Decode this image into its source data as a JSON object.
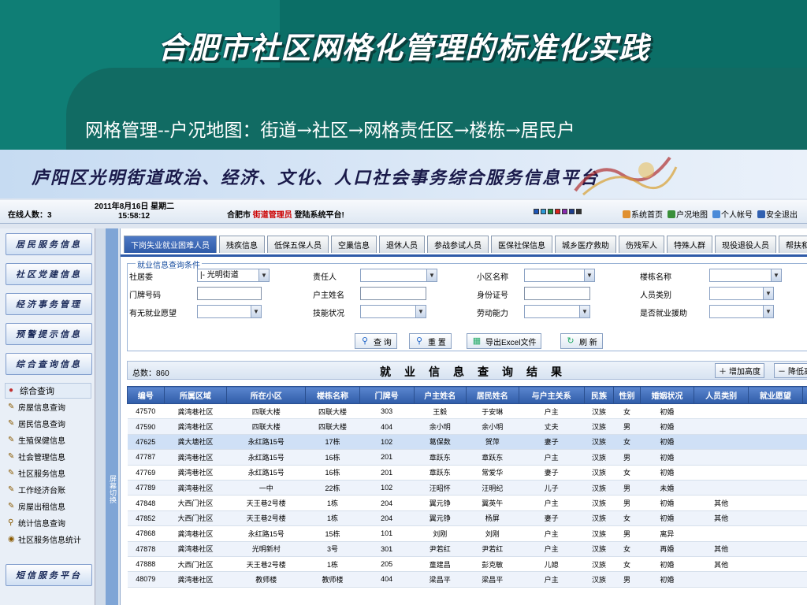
{
  "slide": {
    "title": "合肥市社区网格化管理的标准化实践",
    "subtitle": "网格管理--户况地图：街道→社区→网格责任区→楼栋→居民户"
  },
  "banner": {
    "title": "庐阳区光明街道政治、经济、文化、人口社会事务综合服务信息平台"
  },
  "topbar": {
    "online": "在线人数：3",
    "date": "2011年8月16日  星期二",
    "time": "15:58:12",
    "city": "合肥市",
    "role": "街道管理员",
    "welcome": "登陆系统平台!",
    "colors": [
      "#1e56b8",
      "#2c9ad8",
      "#1d8c3a",
      "#d8221c",
      "#8a2cb0",
      "#1b3d8f",
      "#333333"
    ],
    "links": [
      {
        "icon": "mail-icon",
        "label": "系统首页"
      },
      {
        "icon": "map-icon",
        "label": "户况地图"
      },
      {
        "icon": "user-icon",
        "label": "个人帐号"
      },
      {
        "icon": "exit-icon",
        "label": "安全退出"
      }
    ]
  },
  "sidebar": {
    "buttons": [
      "居民服务信息",
      "社区党建信息",
      "经济事务管理",
      "预警提示信息",
      "综合查询信息"
    ],
    "bottom_button": "短信服务平台",
    "tree_head": "综合查询",
    "tree_items": [
      "房屋信息查询",
      "居民信息查询",
      "生殖保健信息",
      "社会管理信息",
      "社区服务信息",
      "工作经济台账",
      "房屋出租信息",
      "统计信息查询",
      "社区服务信息统计"
    ],
    "strip_label": "屏幕切换"
  },
  "tabs": [
    "下岗失业就业困难人员",
    "残疾信息",
    "低保五保人员",
    "空巢信息",
    "退休人员",
    "参战参试人员",
    "医保社保信息",
    "城乡医疗救助",
    "伤残军人",
    "特殊人群",
    "现役退役人员",
    "帮扶和慰问"
  ],
  "query": {
    "legend": "就业信息查询条件",
    "labels": {
      "committee": "社居委",
      "owner": "责任人",
      "community": "小区名称",
      "building": "楼栋名称",
      "door": "门牌号码",
      "householder": "户主姓名",
      "idcard": "身份证号",
      "category": "人员类别",
      "will": "有无就业愿望",
      "skill": "技能状况",
      "ability": "劳动能力",
      "assist": "是否就业援助"
    },
    "committee_value": "|- 光明街道",
    "buttons": {
      "search": "查 询",
      "reset": "重 置",
      "export": "导出Excel文件",
      "refresh": "刷 新"
    }
  },
  "results": {
    "total": "总数：860",
    "title": "就业信息查询结果",
    "increase": "增加高度",
    "decrease": "降低高度",
    "columns": [
      "编号",
      "所属区域",
      "所在小区",
      "楼栋名称",
      "门牌号",
      "户主姓名",
      "居民姓名",
      "与户主关系",
      "民族",
      "性别",
      "婚姻状况",
      "人员类别",
      "就业愿望",
      "技"
    ],
    "rows": [
      [
        "47570",
        "龚湾巷社区",
        "四联大楼",
        "四联大楼",
        "303",
        "王毅",
        "于安琳",
        "户主",
        "汉族",
        "女",
        "初婚",
        "",
        "",
        ""
      ],
      [
        "47590",
        "龚湾巷社区",
        "四联大楼",
        "四联大楼",
        "404",
        "余小明",
        "余小明",
        "丈夫",
        "汉族",
        "男",
        "初婚",
        "",
        "",
        ""
      ],
      [
        "47625",
        "龚大塘社区",
        "永红路15号",
        "17栋",
        "102",
        "葛保数",
        "贺萍",
        "妻子",
        "汉族",
        "女",
        "初婚",
        "",
        "",
        ""
      ],
      [
        "47787",
        "龚湾巷社区",
        "永红路15号",
        "16栋",
        "201",
        "章跃东",
        "章跃东",
        "户主",
        "汉族",
        "男",
        "初婚",
        "",
        "",
        ""
      ],
      [
        "47769",
        "龚湾巷社区",
        "永红路15号",
        "16栋",
        "201",
        "章跃东",
        "常爱华",
        "妻子",
        "汉族",
        "女",
        "初婚",
        "",
        "",
        ""
      ],
      [
        "47789",
        "龚湾巷社区",
        "一中",
        "22栋",
        "102",
        "汪昭怀",
        "汪明纪",
        "儿子",
        "汉族",
        "男",
        "未婚",
        "",
        "",
        ""
      ],
      [
        "47848",
        "大西门社区",
        "天王巷2号楼",
        "1栋",
        "204",
        "翼元铮",
        "翼英午",
        "户主",
        "汉族",
        "男",
        "初婚",
        "其他",
        "",
        ""
      ],
      [
        "47852",
        "大西门社区",
        "天王巷2号楼",
        "1栋",
        "204",
        "翼元铮",
        "杨屏",
        "妻子",
        "汉族",
        "女",
        "初婚",
        "其他",
        "",
        ""
      ],
      [
        "47868",
        "龚湾巷社区",
        "永红路15号",
        "15栋",
        "101",
        "刘刚",
        "刘刚",
        "户主",
        "汉族",
        "男",
        "离异",
        "",
        "",
        ""
      ],
      [
        "47878",
        "龚湾巷社区",
        "光明新村",
        "3号",
        "301",
        "尹若红",
        "尹若红",
        "户主",
        "汉族",
        "女",
        "再婚",
        "其他",
        "",
        ""
      ],
      [
        "47888",
        "大西门社区",
        "天王巷2号楼",
        "1栋",
        "205",
        "童建昌",
        "彭克敏",
        "儿媳",
        "汉族",
        "女",
        "初婚",
        "其他",
        "",
        ""
      ],
      [
        "48079",
        "龚湾巷社区",
        "教师楼",
        "教师楼",
        "404",
        "梁昌平",
        "梁昌平",
        "户主",
        "汉族",
        "男",
        "初婚",
        "",
        "",
        ""
      ]
    ]
  }
}
